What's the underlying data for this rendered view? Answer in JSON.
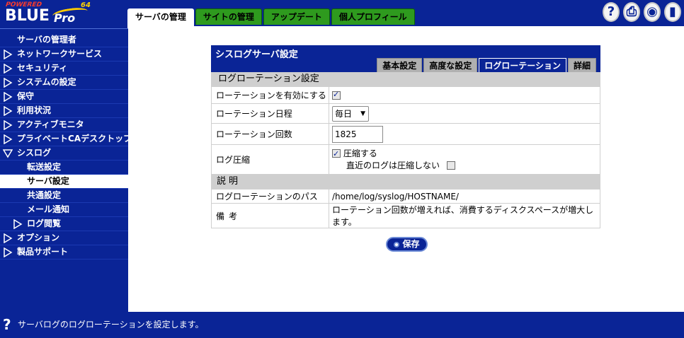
{
  "logo": {
    "powered": "POWERED",
    "brand": "BLUE",
    "pro": "Pro",
    "version": "64"
  },
  "top_tabs": [
    {
      "label": "サーバの管理",
      "active": true
    },
    {
      "label": "サイトの管理",
      "active": false
    },
    {
      "label": "アップデート",
      "active": false
    },
    {
      "label": "個人プロフィール",
      "active": false
    }
  ],
  "top_icons": [
    "help-icon",
    "document-icon",
    "eye-icon",
    "logout-icon"
  ],
  "sidebar": {
    "items": [
      {
        "label": "サーバの管理者",
        "level": 1,
        "arrow": "none"
      },
      {
        "label": "ネットワークサービス",
        "level": 1,
        "arrow": "right"
      },
      {
        "label": "セキュリティ",
        "level": 1,
        "arrow": "right"
      },
      {
        "label": "システムの設定",
        "level": 1,
        "arrow": "right"
      },
      {
        "label": "保守",
        "level": 1,
        "arrow": "right"
      },
      {
        "label": "利用状況",
        "level": 1,
        "arrow": "right"
      },
      {
        "label": "アクティブモニタ",
        "level": 1,
        "arrow": "right"
      },
      {
        "label": "プライベートCAデスクトップ",
        "level": 1,
        "arrow": "right"
      },
      {
        "label": "シスログ",
        "level": 1,
        "arrow": "down"
      },
      {
        "label": "転送設定",
        "level": 2,
        "arrow": "none"
      },
      {
        "label": "サーバ設定",
        "level": 2,
        "arrow": "none",
        "active": true
      },
      {
        "label": "共通設定",
        "level": 2,
        "arrow": "none"
      },
      {
        "label": "メール通知",
        "level": 2,
        "arrow": "none"
      },
      {
        "label": "ログ閲覧",
        "level": 2,
        "arrow": "right"
      },
      {
        "label": "オプション",
        "level": 1,
        "arrow": "right"
      },
      {
        "label": "製品サポート",
        "level": 1,
        "arrow": "right"
      }
    ]
  },
  "panel": {
    "title": "シスログサーバ設定",
    "tabs": [
      {
        "label": "基本設定",
        "active": false
      },
      {
        "label": "高度な設定",
        "active": false
      },
      {
        "label": "ログローテーション",
        "active": true
      },
      {
        "label": "詳細",
        "active": false
      }
    ],
    "section_title": "ログローテーション設定",
    "rows": {
      "enable": {
        "label": "ローテーションを有効にする",
        "checked": true
      },
      "schedule": {
        "label": "ローテーション日程",
        "value": "毎日"
      },
      "count": {
        "label": "ローテーション回数",
        "value": "1825"
      },
      "compress": {
        "label": "ログ圧縮",
        "compress_label": "圧縮する",
        "compress_checked": true,
        "recent_label": "直近のログは圧縮しない",
        "recent_checked": false
      }
    },
    "desc_title": "説明",
    "desc_rows": [
      {
        "label": "ログローテーションのパス",
        "value": "/home/log/syslog/HOSTNAME/"
      },
      {
        "label": "備考",
        "value": "ローテーション回数が増えれば、消費するディスクスペースが増大します。"
      }
    ],
    "save_label": "保存"
  },
  "status": {
    "message": "サーバログのログローテーションを設定します。"
  },
  "colors": {
    "navy": "#0a2496",
    "tab_green": "#2e9a1e",
    "section_gray": "#cfcfcf"
  }
}
